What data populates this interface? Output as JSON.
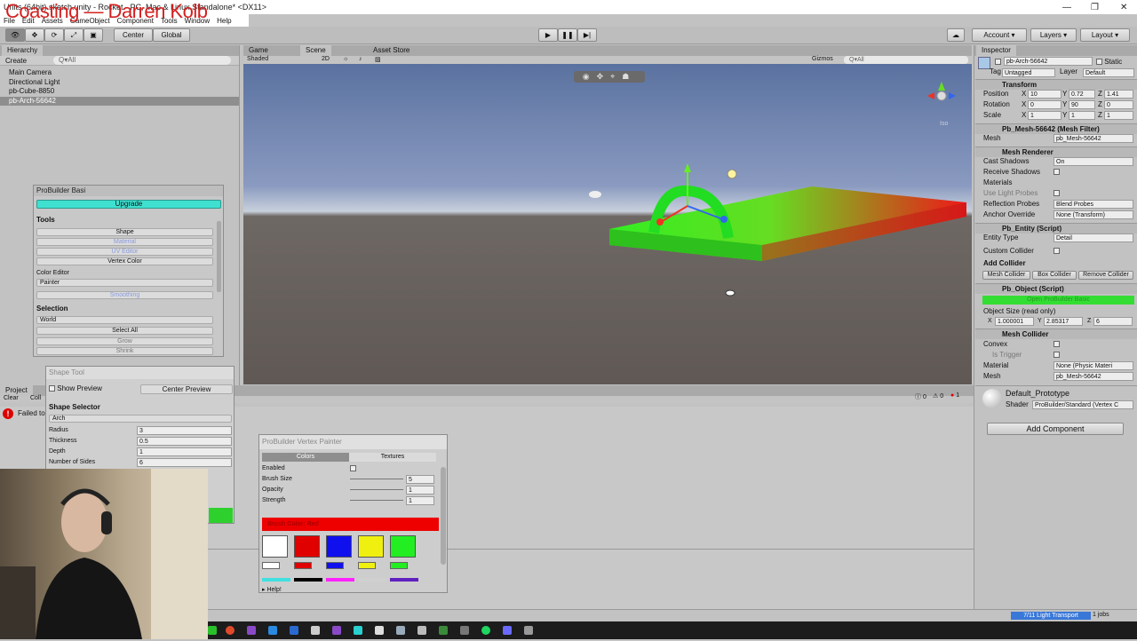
{
  "window": {
    "title": "Units (64bit) sketch.unity - Rocket - PC, Mac & Linux Standalone* <DX11>",
    "overlay": "Coasting — Darren Kolb",
    "controls": [
      "—",
      "❐",
      "✕"
    ]
  },
  "menu": [
    "File",
    "Edit",
    "Assets",
    "GameObject",
    "Component",
    "Tools",
    "Window",
    "Help"
  ],
  "toolbar": {
    "center": "Center",
    "global": "Global",
    "account": "Account",
    "layers": "Layers",
    "layout": "Layout"
  },
  "hierarchy": {
    "tab": "Hierarchy",
    "create": "Create",
    "search": "Q▾All",
    "items": [
      "Main Camera",
      "Directional Light",
      "pb-Cube-8850",
      "pb-Arch-56642"
    ]
  },
  "scene": {
    "tabs": [
      "Game",
      "Scene",
      "Asset Store"
    ],
    "shading": "Shaded",
    "mode2d": "2D",
    "gizmos": "Gizmos",
    "search": "Q▾All",
    "iso": "Iso"
  },
  "probuilder": {
    "title": "ProBuilder Basi",
    "upgrade": "Upgrade",
    "tools_label": "Tools",
    "shape": "Shape",
    "material": "Material",
    "uv_editor": "UV Editor",
    "vertex_color": "Vertex Color",
    "color_editor_label": "Color Editor",
    "painter": "Painter",
    "smoothing": "Smoothing",
    "selection_label": "Selection",
    "world": "World",
    "select_all": "Select All",
    "grow": "Grow",
    "shrink": "Shrink"
  },
  "shape_tool": {
    "title": "Shape Tool",
    "show_preview": "Show Preview",
    "center_preview": "Center Preview",
    "selector_label": "Shape Selector",
    "shape": "Arch",
    "fields": [
      {
        "label": "Radius",
        "value": "3"
      },
      {
        "label": "Thickness",
        "value": "0.5"
      },
      {
        "label": "Depth",
        "value": "1"
      },
      {
        "label": "Number of Sides",
        "value": "6"
      }
    ]
  },
  "project": {
    "tab": "Project",
    "console_clear": "Clear",
    "console_collapse": "Coll",
    "error_text": "Failed to",
    "counts": [
      "0",
      "0",
      "1"
    ]
  },
  "vertex_painter": {
    "title": "ProBuilder Vertex Painter",
    "tab_colors": "Colors",
    "tab_textures": "Textures",
    "enabled": "Enabled",
    "brush_size_label": "Brush Size",
    "brush_size": "5",
    "opacity_label": "Opacity",
    "opacity": "1",
    "strength_label": "Strength",
    "strength": "1",
    "brush_color": "Brush Color: Red",
    "help": "Help!",
    "swatches": [
      "#ffffff",
      "#e00000",
      "#1010ee",
      "#f0f010",
      "#22ee22"
    ],
    "row2": [
      "#ff30ff",
      "#000000",
      "#ff22ff",
      "#d0d0d0",
      "#6020c0"
    ]
  },
  "inspector": {
    "tab": "Inspector",
    "name": "pb-Arch-56642",
    "static": "Static",
    "tag_label": "Tag",
    "tag": "Untagged",
    "layer_label": "Layer",
    "layer": "Default",
    "transform": "Transform",
    "position_label": "Position",
    "position": [
      "10",
      "0.72",
      "1.41"
    ],
    "rotation_label": "Rotation",
    "rotation": [
      "0",
      "90",
      "0"
    ],
    "scale_label": "Scale",
    "scale": [
      "1",
      "1",
      "1"
    ],
    "mesh_filter": "Pb_Mesh-56642 (Mesh Filter)",
    "mesh_label": "Mesh",
    "mesh_value": "pb_Mesh-56642",
    "mesh_renderer": "Mesh Renderer",
    "cast_shadows_label": "Cast Shadows",
    "cast_shadows": "On",
    "receive_shadows": "Receive Shadows",
    "materials": "Materials",
    "light_probes": "Use Light Probes",
    "reflection_label": "Reflection Probes",
    "reflection": "Blend Probes",
    "anchor_label": "Anchor Override",
    "anchor": "None (Transform)",
    "entity": "Pb_Entity (Script)",
    "entity_type_label": "Entity Type",
    "entity_type": "Detail",
    "custom_collider": "Custom Collider",
    "add_collider": "Add Collider",
    "collider_btns": [
      "Mesh Collider",
      "Box Collider",
      "Remove Collider"
    ],
    "pb_object": "Pb_Object (Script)",
    "open_basic": "Open ProBuilder Basic",
    "object_size": "Object Size (read only)",
    "size": [
      "1.000001",
      "2.85317",
      "6"
    ],
    "mesh_collider": "Mesh Collider",
    "convex": "Convex",
    "is_trigger": "Is Trigger",
    "material_label": "Material",
    "material_value": "None (Physic Materi",
    "mc_mesh_value": "pb_Mesh-56642",
    "default_mat": "Default_Prototype",
    "shader_label": "Shader",
    "shader": "ProBuilder/Standard (Vertex C",
    "add_component": "Add Component"
  },
  "status": {
    "light_transport": "7/11 Light Transport",
    "jobs": "1 jobs"
  }
}
